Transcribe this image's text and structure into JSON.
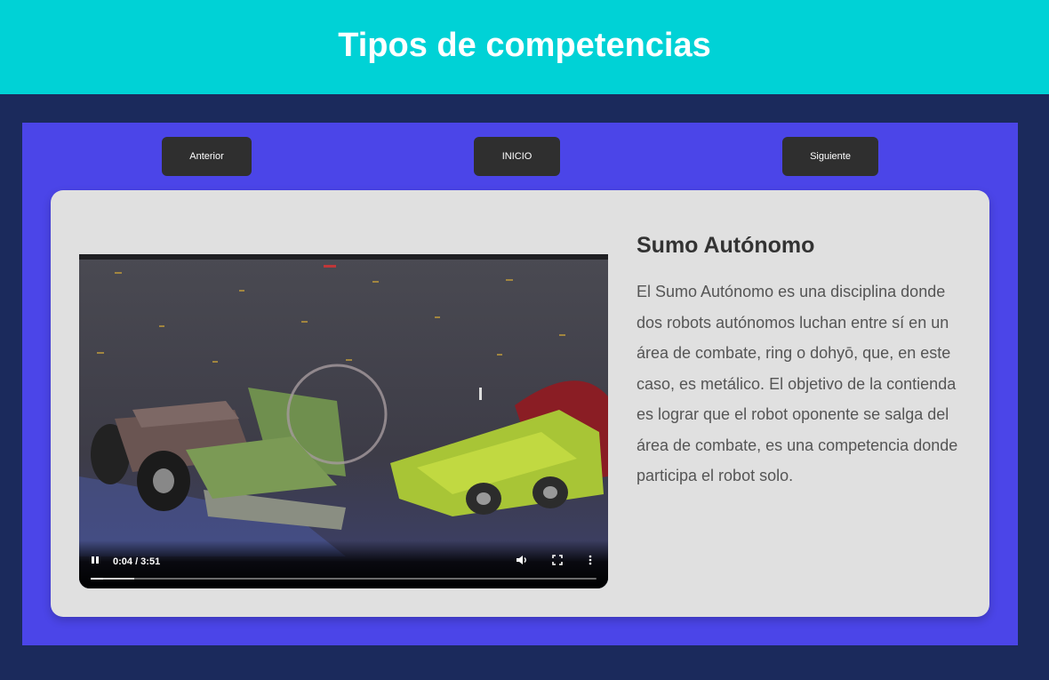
{
  "header": {
    "title": "Tipos de competencias"
  },
  "nav": {
    "prev_label": "Anterior",
    "home_label": "INICIO",
    "next_label": "Siguiente"
  },
  "content": {
    "title": "Sumo Autónomo",
    "description": "El Sumo Autónomo es una disciplina donde dos robots autónomos luchan entre sí en un área de combate, ring o dohyō, que, en este caso, es metálico. El objetivo de la contienda es lograr que el robot oponente se salga del área de combate, es una competencia donde participa el robot solo."
  },
  "video": {
    "current_time": "0:04",
    "duration": "3:51",
    "time_display": "0:04 / 3:51",
    "played_fraction": 0.024,
    "buffered_fraction": 0.086,
    "state": "playing"
  },
  "colors": {
    "header_bg": "#00d2d6",
    "page_bg": "#1b2a5c",
    "panel_bg": "#4b45e8",
    "card_bg": "#e0e0e0",
    "button_bg": "#2f2f2f"
  },
  "icons": [
    "pause-icon",
    "volume-icon",
    "fullscreen-icon",
    "more-options-icon"
  ]
}
